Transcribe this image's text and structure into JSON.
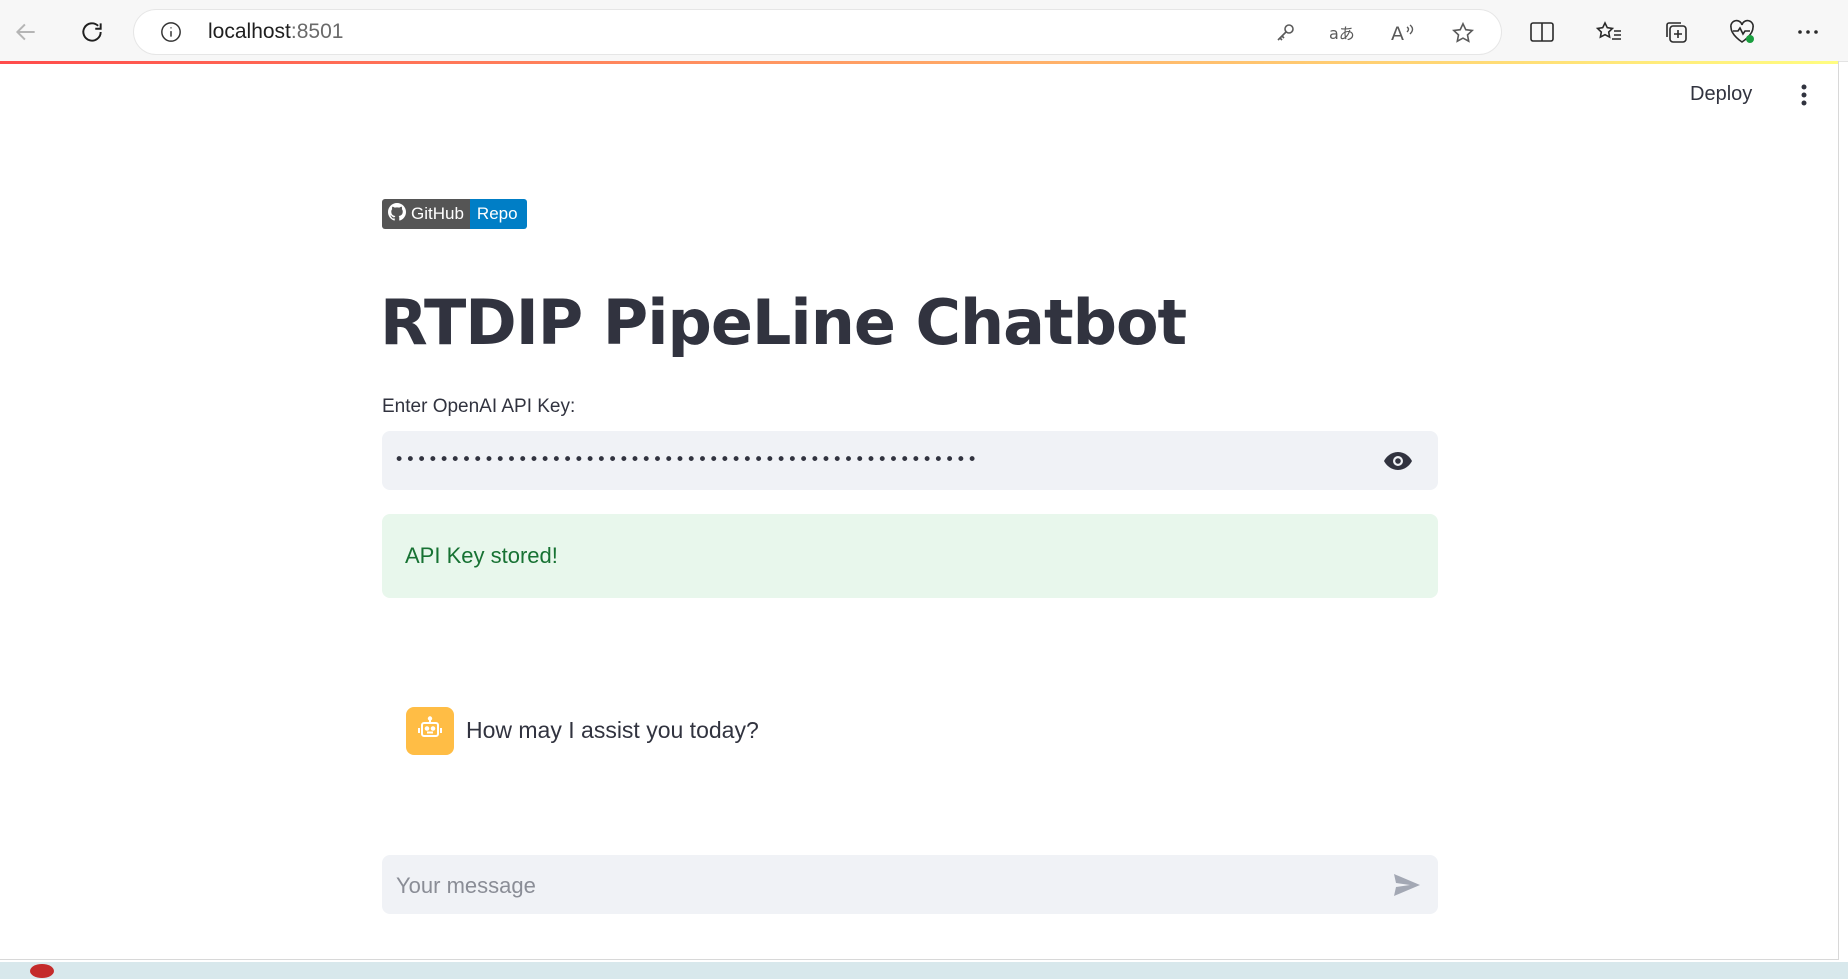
{
  "browser": {
    "url_host": "localhost",
    "url_port": ":8501",
    "icons": [
      "back-arrow-icon",
      "refresh-icon",
      "info-icon",
      "key-icon",
      "translate-icon",
      "read-aloud-icon",
      "favorite-star-icon",
      "split-screen-icon",
      "favorites-list-icon",
      "collections-icon",
      "browser-essentials-icon",
      "more-icon"
    ]
  },
  "app": {
    "header": {
      "deploy_label": "Deploy"
    },
    "badge": {
      "left_text": "GitHub",
      "right_text": "Repo"
    },
    "title": "RTDIP PipeLine Chatbot",
    "api_key": {
      "label": "Enter OpenAI API Key:",
      "value": "••••••••••••••••••••••••••••••••••••••••••••••••••••"
    },
    "success_message": "API Key stored!",
    "messages": [
      {
        "role": "assistant",
        "text": "How may I assist you today?"
      }
    ],
    "chat_input": {
      "placeholder": "Your message"
    }
  },
  "colors": {
    "accent_gradient_start": "#ff4b4b",
    "accent_gradient_end": "#fffd80",
    "success_bg": "#e8f7ec",
    "success_text": "#177233",
    "avatar_bg": "#ffbd45",
    "badge_left": "#555555",
    "badge_right": "#007ec6"
  }
}
